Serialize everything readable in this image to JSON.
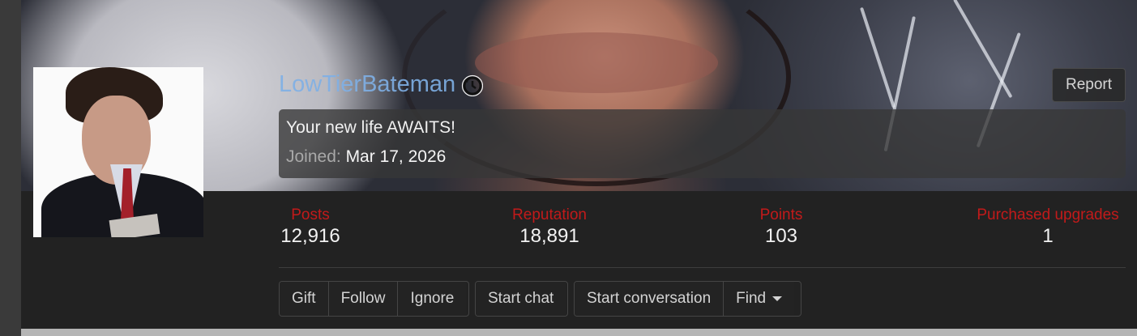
{
  "profile": {
    "username": "LowTierBateman",
    "username_color": "#7fb0e6",
    "badge_icon": "clock-rewind-icon",
    "status": "Your new life AWAITS!",
    "joined_label": "Joined:",
    "joined_date": "Mar 17, 2026",
    "report_label": "Report",
    "avatar_icon": "user-avatar-photo",
    "banner_image": "cover-photo"
  },
  "stats": [
    {
      "label": "Posts",
      "value": "12,916"
    },
    {
      "label": "Reputation",
      "value": "18,891"
    },
    {
      "label": "Points",
      "value": "103"
    },
    {
      "label": "Purchased upgrades",
      "value": "1"
    }
  ],
  "actions": {
    "gift": "Gift",
    "follow": "Follow",
    "ignore": "Ignore",
    "start_chat": "Start chat",
    "start_conversation": "Start conversation",
    "find": "Find"
  },
  "colors": {
    "stat_label": "#c21a1a",
    "panel_bg": "#222222",
    "accent_link": "#7fb0e6"
  }
}
